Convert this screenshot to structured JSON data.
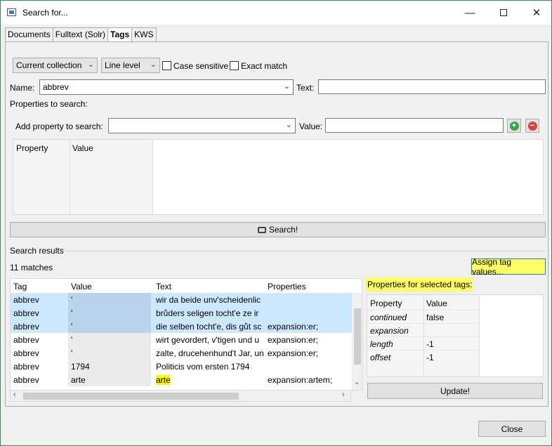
{
  "window": {
    "title": "Search for...",
    "minimize_glyph": "—",
    "close_glyph": "✕"
  },
  "tabs": [
    {
      "label": "Documents"
    },
    {
      "label": "Fulltext (Solr)"
    },
    {
      "label": "Tags"
    },
    {
      "label": "KWS"
    }
  ],
  "filters": {
    "scope": "Current collection",
    "level": "Line level",
    "case_sensitive": "Case sensitive",
    "exact_match": "Exact match"
  },
  "name_row": {
    "name_label": "Name:",
    "name_value": "abbrev",
    "text_label": "Text:",
    "text_value": ""
  },
  "properties": {
    "section_label": "Properties to search:",
    "add_label": "Add property to search:",
    "value_label": "Value:",
    "add_icon": "plus-icon",
    "remove_icon": "minus-icon",
    "table_headers": [
      "Property",
      "Value"
    ]
  },
  "search_button": {
    "label": "Search!",
    "icon": "binoculars-icon"
  },
  "results": {
    "section_label": "Search results",
    "matches": "11 matches",
    "assign_button": "Assign tag values...",
    "headers": [
      "Tag",
      "Value",
      "Text",
      "Properties"
    ],
    "rows": [
      {
        "tag": "abbrev",
        "value": "'",
        "text": "wir da beide unv'scheidenlic",
        "props": "",
        "selected": true
      },
      {
        "tag": "abbrev",
        "value": "'",
        "text": "brůders seligen tocht'e ze ir",
        "props": "",
        "selected": true
      },
      {
        "tag": "abbrev",
        "value": "'",
        "text": "die selben tocht'e, dis gůt sc",
        "props": "expansion:er;",
        "selected": true
      },
      {
        "tag": "abbrev",
        "value": "'",
        "text": "wirt gevordert, v'tigen und u",
        "props": "expansion:er;",
        "selected": false
      },
      {
        "tag": "abbrev",
        "value": "'",
        "text": "zalte, drucehenhund't Jar, un",
        "props": "expansion:er;",
        "selected": false
      },
      {
        "tag": "abbrev",
        "value": "1794",
        "text": "Politicis vom ersten 1794",
        "props": "",
        "selected": false
      },
      {
        "tag": "abbrev",
        "value": "arte",
        "text": "arte",
        "props": "expansion:artem;",
        "selected": false
      }
    ]
  },
  "selected_tags": {
    "title": "Properties for selected tags:",
    "headers": [
      "Property",
      "Value"
    ],
    "rows": [
      {
        "property": "continued",
        "value": "false"
      },
      {
        "property": "expansion",
        "value": ""
      },
      {
        "property": "length",
        "value": "-1"
      },
      {
        "property": "offset",
        "value": "-1"
      }
    ],
    "update_button": "Update!"
  },
  "footer": {
    "close_button": "Close"
  }
}
